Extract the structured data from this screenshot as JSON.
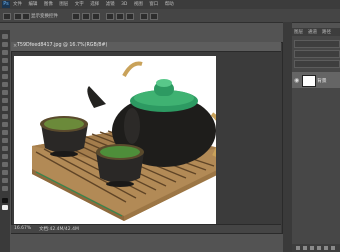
{
  "app": {
    "logo_text": "Ps"
  },
  "menubar": {
    "items": [
      "文件",
      "编辑",
      "图像",
      "图层",
      "文字",
      "选择",
      "滤镜",
      "3D",
      "视图",
      "窗口",
      "帮助"
    ]
  },
  "optbar": {
    "items": [
      "显示变换控件"
    ]
  },
  "document": {
    "title": "T59Dfeed8417.jpg @ 16.7%(RGB/8#)",
    "zoom": "16.67%",
    "doc_size": "文档:42.4M/42.4M"
  },
  "layers_panel": {
    "tabs": [
      "图层",
      "通道",
      "路径"
    ],
    "layer_name": "背景"
  },
  "colors": {
    "pot_green": "#2d9a62",
    "pot_dark": "#1e1d1b",
    "tray_wood": "#b28a56"
  }
}
